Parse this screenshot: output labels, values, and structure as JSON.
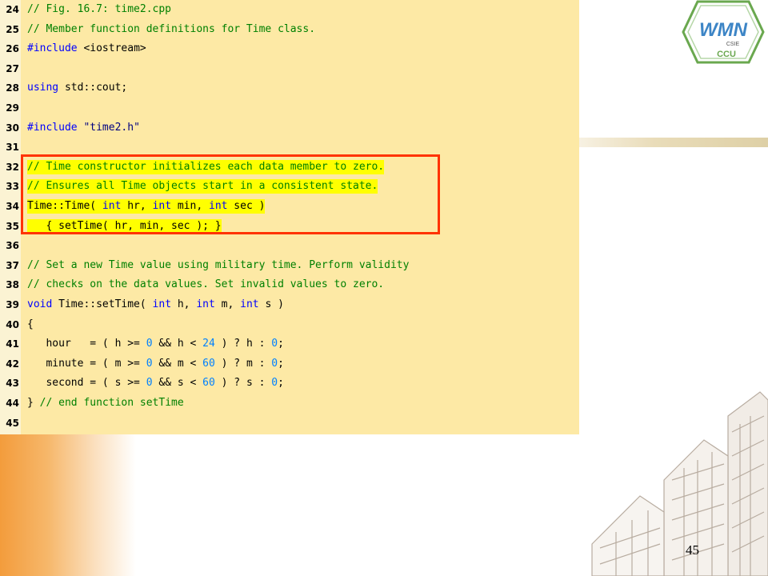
{
  "slide": {
    "page_number": "45"
  },
  "logo": {
    "title": "WMN",
    "subtitle": "CSIE",
    "org": "CCU"
  },
  "code": {
    "lines": [
      {
        "num": "24",
        "highlight": false,
        "tokens": [
          {
            "t": "// Fig. 16.7: time2.cpp",
            "c": "comment"
          }
        ]
      },
      {
        "num": "25",
        "highlight": false,
        "tokens": [
          {
            "t": "// Member function definitions for Time class.",
            "c": "comment"
          }
        ]
      },
      {
        "num": "26",
        "highlight": false,
        "tokens": [
          {
            "t": "#include",
            "c": "keyword"
          },
          {
            "t": " <iostream>",
            "c": "text"
          }
        ]
      },
      {
        "num": "27",
        "highlight": false,
        "tokens": []
      },
      {
        "num": "28",
        "highlight": false,
        "tokens": [
          {
            "t": "using",
            "c": "keyword"
          },
          {
            "t": " std::cout;",
            "c": "text"
          }
        ]
      },
      {
        "num": "29",
        "highlight": false,
        "tokens": []
      },
      {
        "num": "30",
        "highlight": false,
        "tokens": [
          {
            "t": "#include",
            "c": "keyword"
          },
          {
            "t": " ",
            "c": "text"
          },
          {
            "t": "\"time2.h\"",
            "c": "string"
          }
        ]
      },
      {
        "num": "31",
        "highlight": false,
        "tokens": []
      },
      {
        "num": "32",
        "highlight": true,
        "tokens": [
          {
            "t": "// Time constructor initializes each data member to zero.",
            "c": "comment"
          }
        ]
      },
      {
        "num": "33",
        "highlight": true,
        "tokens": [
          {
            "t": "// Ensures all Time objects start in a consistent state.",
            "c": "comment"
          }
        ]
      },
      {
        "num": "34",
        "highlight": true,
        "tokens": [
          {
            "t": "Time::Time( ",
            "c": "text"
          },
          {
            "t": "int",
            "c": "keyword"
          },
          {
            "t": " hr, ",
            "c": "text"
          },
          {
            "t": "int",
            "c": "keyword"
          },
          {
            "t": " min, ",
            "c": "text"
          },
          {
            "t": "int",
            "c": "keyword"
          },
          {
            "t": " sec )",
            "c": "text"
          }
        ]
      },
      {
        "num": "35",
        "highlight": true,
        "tokens": [
          {
            "t": "   { setTime( hr, min, sec ); }",
            "c": "text"
          }
        ]
      },
      {
        "num": "36",
        "highlight": false,
        "tokens": []
      },
      {
        "num": "37",
        "highlight": false,
        "tokens": [
          {
            "t": "// Set a new Time value using military time. Perform validity",
            "c": "comment"
          }
        ]
      },
      {
        "num": "38",
        "highlight": false,
        "tokens": [
          {
            "t": "// checks on the data values. Set invalid values to zero.",
            "c": "comment"
          }
        ]
      },
      {
        "num": "39",
        "highlight": false,
        "tokens": [
          {
            "t": "void",
            "c": "keyword"
          },
          {
            "t": " Time::setTime( ",
            "c": "text"
          },
          {
            "t": "int",
            "c": "keyword"
          },
          {
            "t": " h, ",
            "c": "text"
          },
          {
            "t": "int",
            "c": "keyword"
          },
          {
            "t": " m, ",
            "c": "text"
          },
          {
            "t": "int",
            "c": "keyword"
          },
          {
            "t": " s )",
            "c": "text"
          }
        ]
      },
      {
        "num": "40",
        "highlight": false,
        "tokens": [
          {
            "t": "{",
            "c": "text"
          }
        ]
      },
      {
        "num": "41",
        "highlight": false,
        "tokens": [
          {
            "t": "   hour   = ( h >= ",
            "c": "text"
          },
          {
            "t": "0",
            "c": "number"
          },
          {
            "t": " && h < ",
            "c": "text"
          },
          {
            "t": "24",
            "c": "number"
          },
          {
            "t": " ) ? h : ",
            "c": "text"
          },
          {
            "t": "0",
            "c": "number"
          },
          {
            "t": ";",
            "c": "text"
          }
        ]
      },
      {
        "num": "42",
        "highlight": false,
        "tokens": [
          {
            "t": "   minute = ( m >= ",
            "c": "text"
          },
          {
            "t": "0",
            "c": "number"
          },
          {
            "t": " && m < ",
            "c": "text"
          },
          {
            "t": "60",
            "c": "number"
          },
          {
            "t": " ) ? m : ",
            "c": "text"
          },
          {
            "t": "0",
            "c": "number"
          },
          {
            "t": ";",
            "c": "text"
          }
        ]
      },
      {
        "num": "43",
        "highlight": false,
        "tokens": [
          {
            "t": "   second = ( s >= ",
            "c": "text"
          },
          {
            "t": "0",
            "c": "number"
          },
          {
            "t": " && s < ",
            "c": "text"
          },
          {
            "t": "60",
            "c": "number"
          },
          {
            "t": " ) ? s : ",
            "c": "text"
          },
          {
            "t": "0",
            "c": "number"
          },
          {
            "t": ";",
            "c": "text"
          }
        ]
      },
      {
        "num": "44",
        "highlight": false,
        "tokens": [
          {
            "t": "} ",
            "c": "text"
          },
          {
            "t": "// end function setTime",
            "c": "comment"
          }
        ]
      },
      {
        "num": "45",
        "highlight": false,
        "tokens": []
      }
    ]
  },
  "colors": {
    "panel_bg": "#fde9a5",
    "highlight": "#ffff00",
    "box_border": "#ff3300",
    "comment": "#008000",
    "keyword": "#0000ff"
  }
}
